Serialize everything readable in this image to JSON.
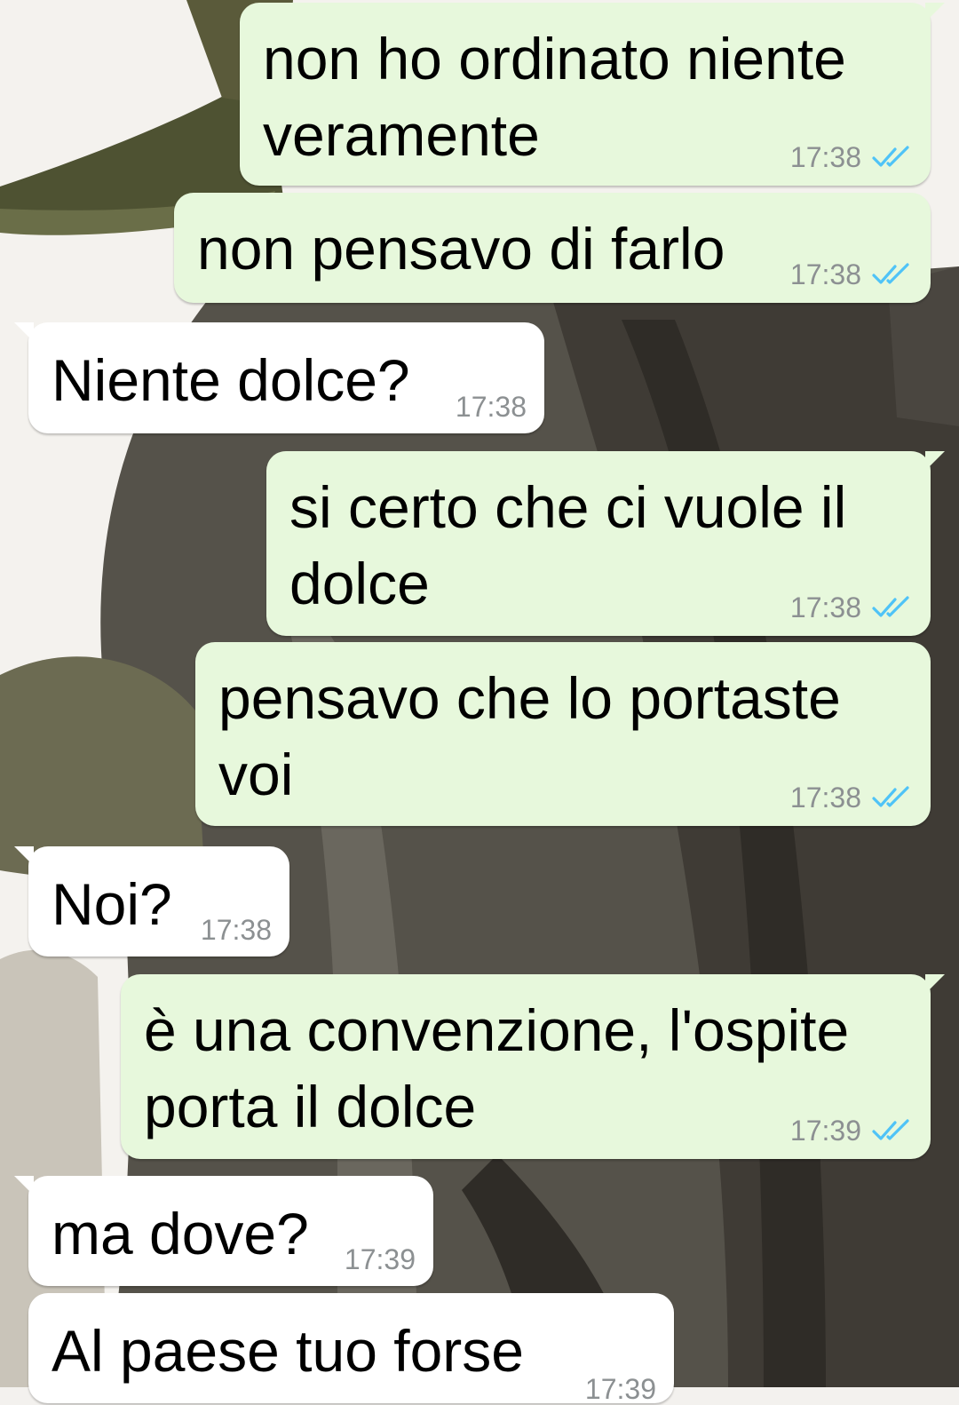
{
  "colors": {
    "outgoing_bubble": "#e7f8dc",
    "incoming_bubble": "#ffffff",
    "timestamp": "#8c9092",
    "read_ticks": "#4fc3f7"
  },
  "icons": {
    "read_receipt": "double-check-icon"
  },
  "messages": [
    {
      "direction": "out",
      "text": "non ho ordinato niente\nveramente",
      "time": "17:38",
      "status": "read"
    },
    {
      "direction": "out",
      "text": "non pensavo di farlo",
      "time": "17:38",
      "status": "read"
    },
    {
      "direction": "in",
      "text": "Niente dolce?",
      "time": "17:38"
    },
    {
      "direction": "out",
      "text": "si certo che ci vuole il\ndolce",
      "time": "17:38",
      "status": "read"
    },
    {
      "direction": "out",
      "text": "pensavo che lo portaste\nvoi",
      "time": "17:38",
      "status": "read"
    },
    {
      "direction": "in",
      "text": "Noi?",
      "time": "17:38"
    },
    {
      "direction": "out",
      "text": "è una convenzione, l'ospite\nporta il dolce",
      "time": "17:39",
      "status": "read"
    },
    {
      "direction": "in",
      "text": "ma dove?",
      "time": "17:39"
    },
    {
      "direction": "in",
      "text": "Al paese tuo forse",
      "time": "17:39"
    }
  ]
}
